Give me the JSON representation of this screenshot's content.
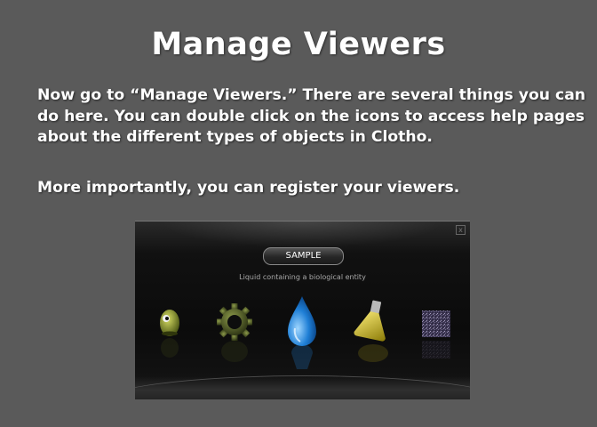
{
  "slide": {
    "title": "Manage Viewers",
    "paragraph1": "Now go to “Manage Viewers.”  There are several things you can do here.  You can double click on the icons to access help pages about the different types of objects in Clotho.",
    "paragraph2": "More importantly, you can register your viewers."
  },
  "viewer_window": {
    "selected_label": "SAMPLE",
    "description": "Liquid containing a biological entity",
    "close_symbol": "x",
    "icons": [
      "bug-icon",
      "gear-icon",
      "water-drop-icon",
      "flask-icon",
      "noise-tile-icon"
    ]
  },
  "colors": {
    "background": "#5a5a5a",
    "window": "#0b0b0b",
    "drop_blue": "#1f7fd6",
    "flask_yellow": "#d8c21b",
    "gear_olive": "#5b6a2e"
  }
}
